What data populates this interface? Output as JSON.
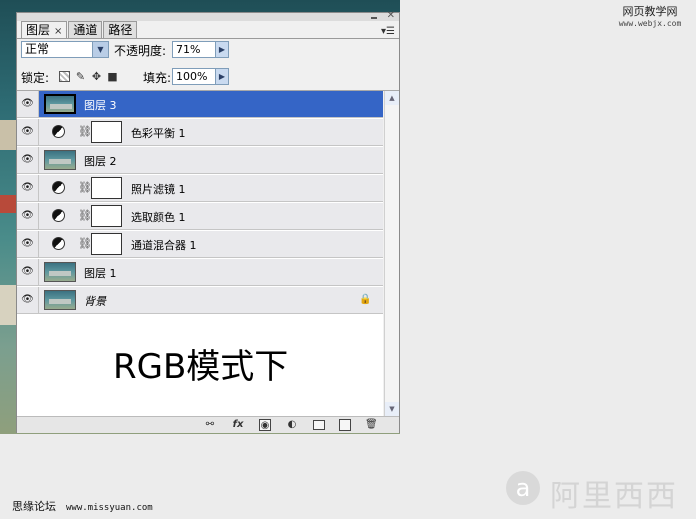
{
  "panel": {
    "tabs": [
      {
        "label": "图层",
        "close": "×"
      },
      {
        "label": "通道"
      },
      {
        "label": "路径"
      }
    ],
    "blend_mode": "正常",
    "opacity_label": "不透明度:",
    "opacity_value": "71%",
    "lock_label": "锁定:",
    "fill_label": "填充:",
    "fill_value": "100%"
  },
  "layers": [
    {
      "name": "图层 3",
      "selected": true,
      "kind": "image"
    },
    {
      "name": "色彩平衡 1",
      "kind": "adjustment"
    },
    {
      "name": "图层 2",
      "kind": "image"
    },
    {
      "name": "照片滤镜 1",
      "kind": "adjustment"
    },
    {
      "name": "选取颜色 1",
      "kind": "adjustment"
    },
    {
      "name": "通道混合器 1",
      "kind": "adjustment"
    },
    {
      "name": "图层 1",
      "kind": "image"
    },
    {
      "name": "背景",
      "kind": "background",
      "locked": true
    }
  ],
  "caption": "RGB模式下",
  "watermarks": {
    "top_right_title": "网页教学网",
    "top_right_url": "www.webjx.com",
    "bottom_left_site": "思缘论坛",
    "bottom_left_url": "www.missyuan.com",
    "bottom_right_logo": "阿里西西"
  },
  "colors": {
    "selection": "#3565c6",
    "panel_bg": "#f0f0f0"
  }
}
